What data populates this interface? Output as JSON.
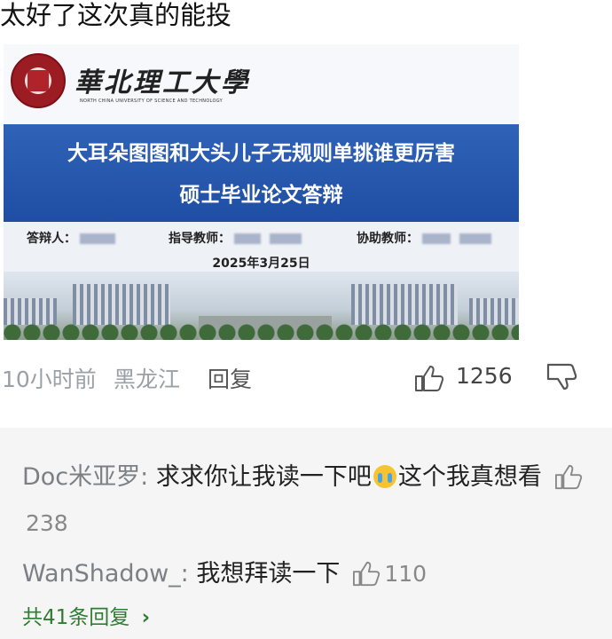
{
  "comment": {
    "text": "太好了这次真的能投",
    "time": "10小时前",
    "location": "黑龙江",
    "reply_label": "回复",
    "like_count": "1256"
  },
  "image": {
    "university_name": "華北理工大學",
    "university_english": "NORTH CHINA UNIVERSITY OF SCIENCE AND TECHNOLOGY",
    "emblem_text": "華北理工大學",
    "banner_title": "大耳朵图图和大头儿子无规则单挑谁更厉害",
    "banner_subtitle": "硕士毕业论文答辩",
    "defender_label": "答辩人：",
    "advisor_label": "指导教师：",
    "assistant_label": "协助教师：",
    "date": "2025年3月25日"
  },
  "replies": {
    "items": [
      {
        "author": "Doc米亚罗",
        "separator": ": ",
        "text_before": "求求你让我读一下吧",
        "emoji": "crying-face",
        "text_after": "这个我真想看",
        "likes": "238"
      },
      {
        "author": "WanShadow_",
        "separator": ": ",
        "text": "我想拜读一下",
        "likes": "110"
      }
    ],
    "total_label": "共41条回复",
    "total_chevron": "›"
  },
  "colors": {
    "banner_blue": "#2f63b8",
    "link_green": "#2f7d32",
    "muted_gray": "#9aa0a6"
  }
}
